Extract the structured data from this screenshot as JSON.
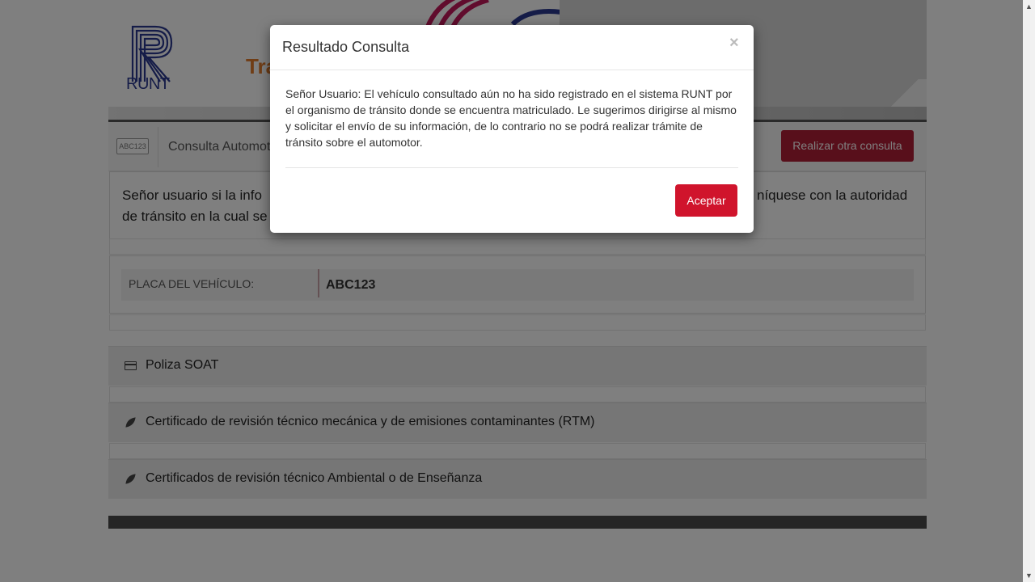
{
  "banner": {
    "logo_text": "RUNT",
    "partial_text": "Tra"
  },
  "toolbar": {
    "plate_icon_text": "ABC123",
    "title": "Consulta Automot",
    "other_query_label": "Realizar otra consulta"
  },
  "notice": {
    "line1_start": "Señor usuario si la info",
    "line1_end": "níquese con la autoridad",
    "line2_start": "de tránsito en la cual se"
  },
  "vehicle": {
    "plate_label": "PLACA DEL VEHÍCULO:",
    "plate_value": "ABC123"
  },
  "sections": [
    {
      "label": "Poliza SOAT",
      "icon": "credit-card-icon"
    },
    {
      "label": "Certificado de revisión técnico mecánica y de emisiones contaminantes (RTM)",
      "icon": "leaf-icon"
    },
    {
      "label": "Certificados de revisión técnico Ambiental o de Enseñanza",
      "icon": "leaf-icon"
    }
  ],
  "modal": {
    "title": "Resultado Consulta",
    "close_symbol": "×",
    "body_lines": [
      "Señor Usuario: El vehículo consultado aún no ha sido registrado en el sistema RUNT por",
      "el organismo de tránsito donde se encuentra matriculado. Le sugerimos dirigirse al mismo",
      "y solicitar el envío de su información, de lo contrario no se podrá realizar trámite de",
      "tránsito sobre el automotor."
    ],
    "accept_label": "Aceptar"
  },
  "colors": {
    "primary_red": "#d0142c",
    "dark_red": "#b01e36",
    "runt_blue": "#2b3990",
    "accent_orange": "#e07a2b"
  }
}
